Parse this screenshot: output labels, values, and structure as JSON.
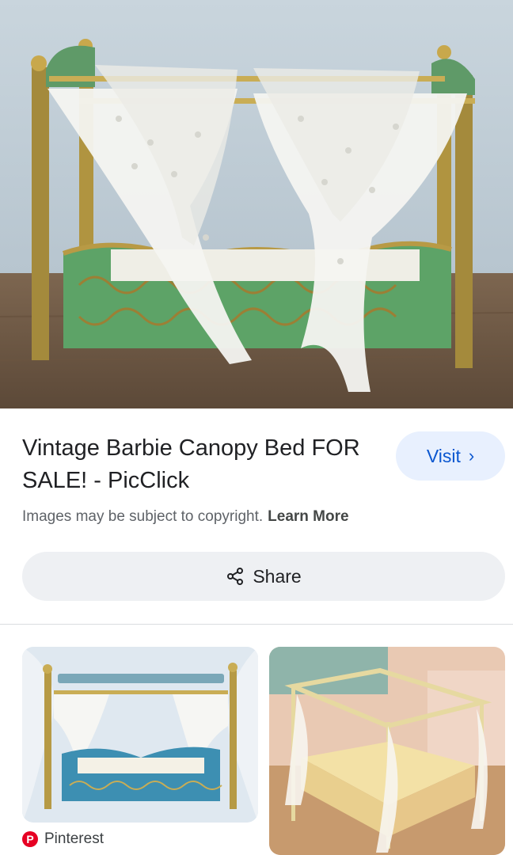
{
  "result": {
    "title": "Vintage Barbie Canopy Bed FOR SALE! - PicClick",
    "visit_label": "Visit",
    "copyright_text": "Images may be subject to copyright.",
    "learn_more_label": "Learn More",
    "share_label": "Share"
  },
  "related": [
    {
      "source": "Pinterest"
    }
  ],
  "icons": {
    "visit": "chevron-right-icon",
    "share": "share-icon",
    "source": "pinterest-icon"
  },
  "colors": {
    "visit_bg": "#e8f0fe",
    "visit_text": "#0b57d0",
    "pinterest": "#e60023"
  }
}
